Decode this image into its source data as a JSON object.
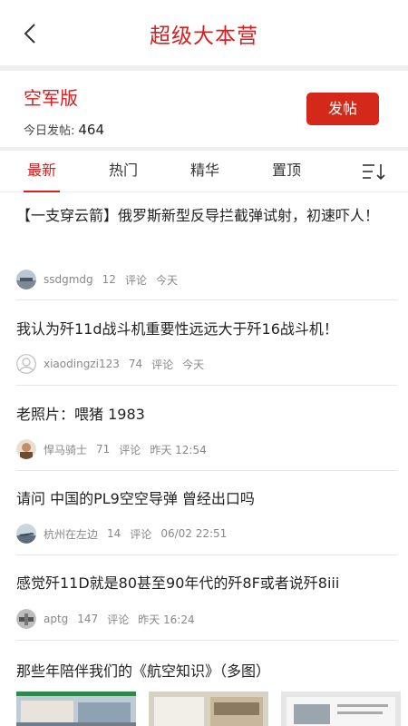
{
  "header": {
    "title": "超级大本营"
  },
  "forum": {
    "name": "空军版",
    "today_label": "今日发帖:",
    "today_count": "464",
    "post_button": "发帖"
  },
  "tabs": [
    {
      "label": "最新"
    },
    {
      "label": "热门"
    },
    {
      "label": "精华"
    },
    {
      "label": "置顶"
    }
  ],
  "posts": [
    {
      "title": "【一支穿云箭】俄罗斯新型反导拦截弹试射，初速吓人！",
      "author": "ssdgmdg",
      "comments": "12",
      "comment_label": "评论",
      "time": "今天"
    },
    {
      "title": "我认为歼11d战斗机重要性远远大于歼16战斗机！",
      "author": "xiaodingzi123",
      "comments": "74",
      "comment_label": "评论",
      "time": "今天"
    },
    {
      "title": "老照片：喂猪 1983",
      "author": "悍马骑士",
      "comments": "71",
      "comment_label": "评论",
      "time": "昨天 12:54"
    },
    {
      "title": "请问 中国的PL9空空导弹 曾经出口吗",
      "author": "杭州在左边",
      "comments": "14",
      "comment_label": "评论",
      "time": "06/02 22:51"
    },
    {
      "title": "感觉歼11D就是80甚至90年代的歼8F或者说歼8iii",
      "author": "aptg",
      "comments": "147",
      "comment_label": "评论",
      "time": "昨天 16:24"
    },
    {
      "title": "那些年陪伴我们的《航空知识》（多图）"
    }
  ],
  "colors": {
    "accent": "#d81e1e",
    "button": "#d4281b"
  }
}
